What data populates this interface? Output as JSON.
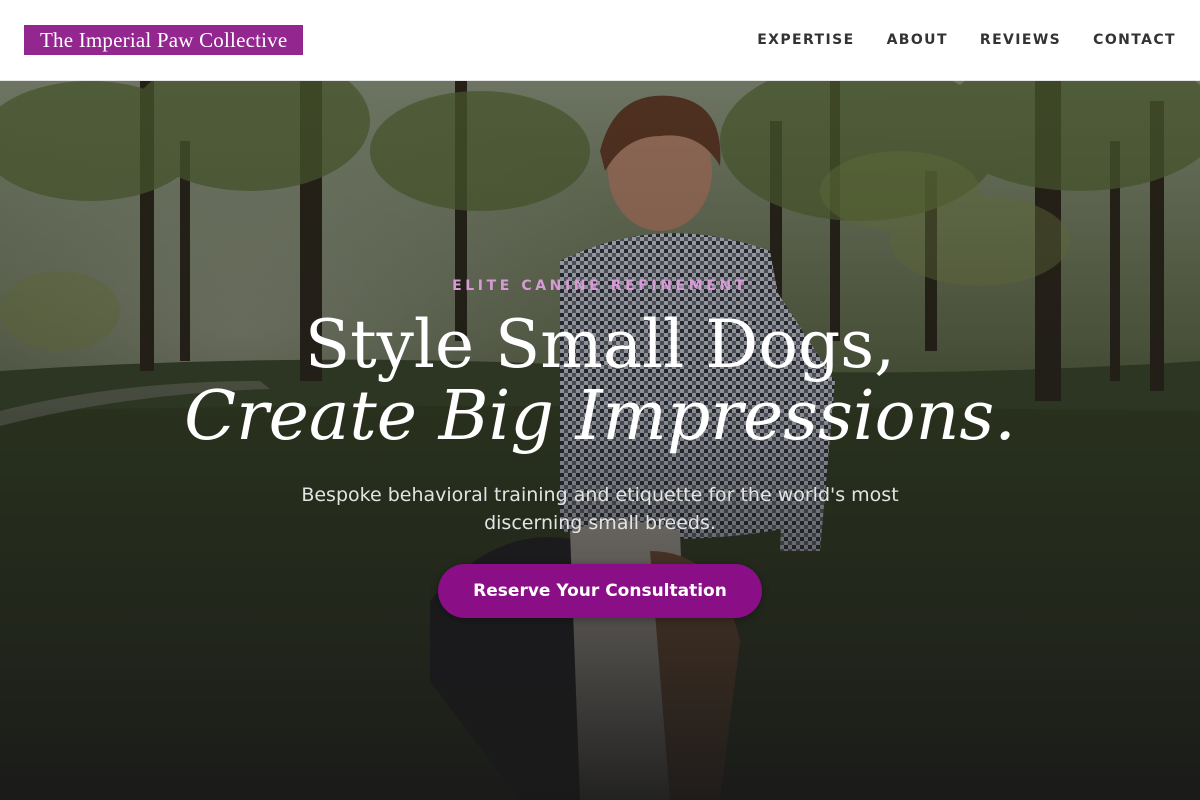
{
  "brand": {
    "name": "The Imperial Paw Collective"
  },
  "nav": {
    "items": [
      {
        "label": "EXPERTISE"
      },
      {
        "label": "ABOUT"
      },
      {
        "label": "REVIEWS"
      },
      {
        "label": "CONTACT"
      }
    ]
  },
  "hero": {
    "eyebrow": "ELITE CANINE REFINEMENT",
    "headline_line1": "Style Small Dogs,",
    "headline_line2": "Create Big Impressions.",
    "subhead": "Bespoke behavioral training and etiquette for the world's most discerning small breeds.",
    "cta_label": "Reserve Your Consultation"
  },
  "colors": {
    "brand_purple": "#93278f",
    "cta_purple": "#8a0f86",
    "eyebrow_pink": "#d79ad6"
  }
}
